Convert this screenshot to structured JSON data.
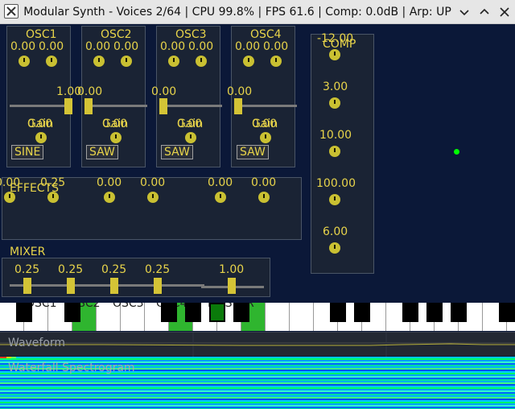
{
  "window": {
    "title": "Modular Synth - Voices 2/64 | CPU 99.8% | FPS 61.6 | Comp: 0.0dB | Arp: UP"
  },
  "oscillators": [
    {
      "name": "OSC1",
      "knob_a": "0.00",
      "knob_b": "0.00",
      "level": "1.00",
      "level_fraction": 1.0,
      "gain_label": "Gain",
      "gain_value": "0.00",
      "waveform": "SINE"
    },
    {
      "name": "OSC2",
      "knob_a": "0.00",
      "knob_b": "0.00",
      "level": "0.00",
      "level_fraction": 0.0,
      "gain_label": "Gain",
      "gain_value": "0.00",
      "waveform": "SAW"
    },
    {
      "name": "OSC3",
      "knob_a": "0.00",
      "knob_b": "0.00",
      "level": "0.00",
      "level_fraction": 0.0,
      "gain_label": "Gain",
      "gain_value": "0.00",
      "waveform": "SAW"
    },
    {
      "name": "OSC4",
      "knob_a": "0.00",
      "knob_b": "0.00",
      "level": "0.00",
      "level_fraction": 0.0,
      "gain_label": "Gain",
      "gain_value": "0.00",
      "waveform": "SAW"
    }
  ],
  "effects": {
    "title": "EFFECTS",
    "values": [
      "0.00",
      "0.25",
      "0.00",
      "0.00",
      "0.00",
      "0.00"
    ]
  },
  "comp": {
    "title": "COMP",
    "values": [
      "-12.00",
      "3.00",
      "10.00",
      "100.00",
      "6.00"
    ]
  },
  "mixer": {
    "title": "MIXER",
    "values": [
      "0.25",
      "0.25",
      "0.25",
      "0.25",
      "1.00"
    ],
    "fractions": [
      0.25,
      0.25,
      0.25,
      0.25,
      1.0
    ]
  },
  "keyboard": {
    "overlay_labels": [
      "OSC1",
      "OSC2",
      "OSC3",
      "OSC4",
      "MASTER"
    ],
    "pressed_white_keys": [
      3,
      7,
      10
    ],
    "pressed_black_key": "F#",
    "pressed_color": "#2fb52f"
  },
  "waveform_panel": {
    "title": "Waveform"
  },
  "spectrogram_panel": {
    "title": "Waterfall Spectrogram"
  },
  "colors": {
    "accent": "#e8d44a",
    "background": "#0b1838",
    "cursor": "#00ff00"
  }
}
